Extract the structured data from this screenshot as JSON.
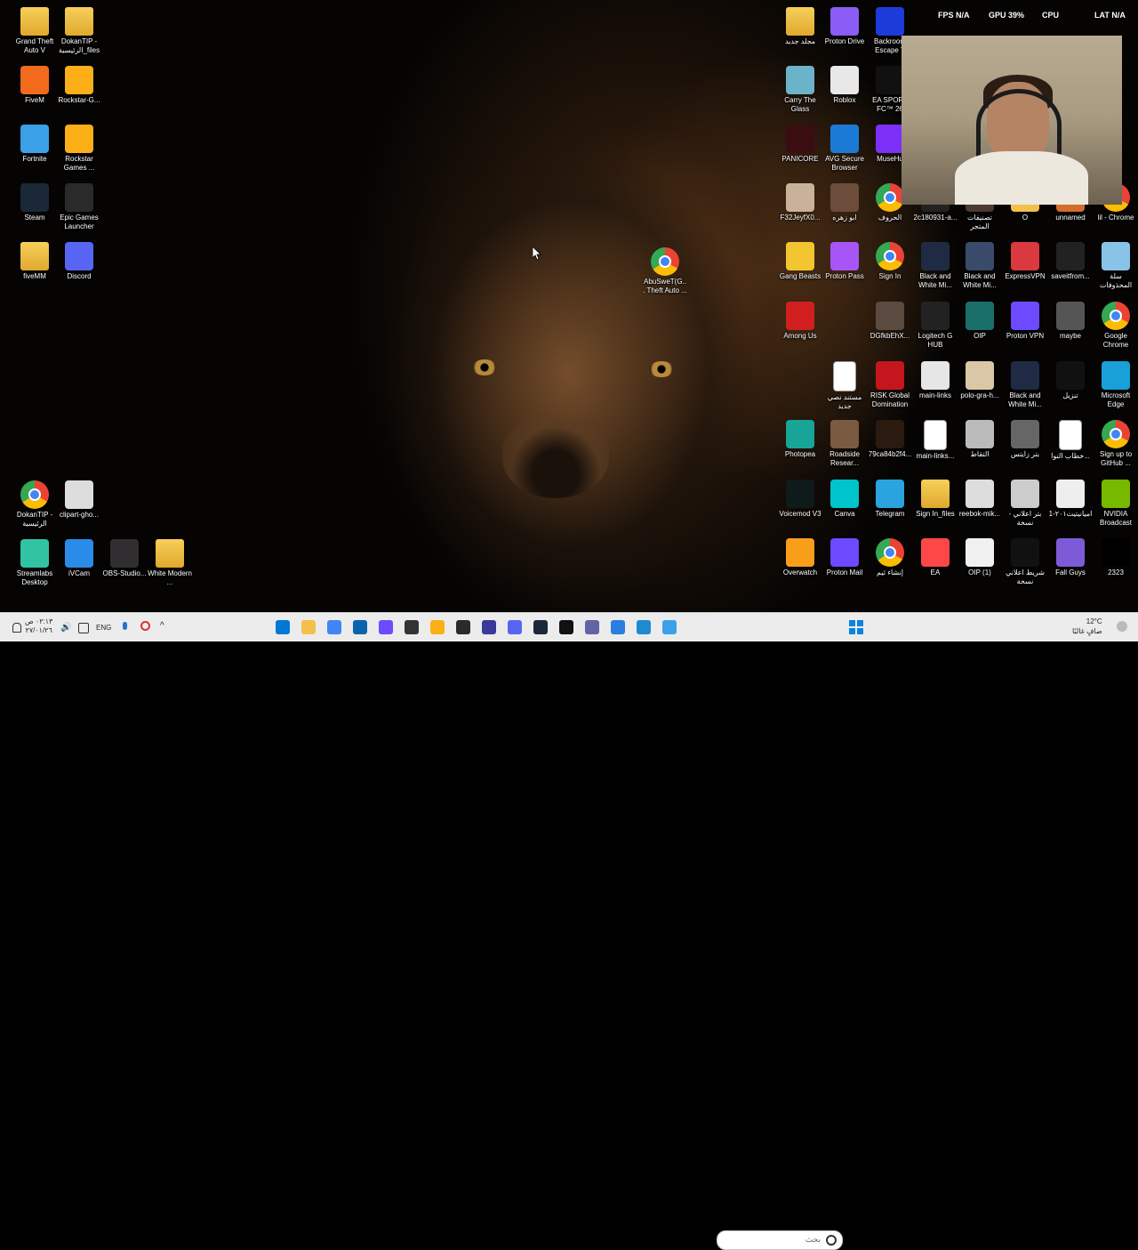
{
  "desktop_left": [
    {
      "label": "Grand Theft Auto V",
      "icon": "folder-icon",
      "kind": "folder"
    },
    {
      "label": "DokanTIP - الرئيسية_files",
      "icon": "folder-icon",
      "kind": "folder"
    },
    {
      "label": "FiveM",
      "icon": "fivem-icon",
      "color": "#f26a1b"
    },
    {
      "label": "Rockstar-G...",
      "icon": "rockstar-icon",
      "color": "#fcaf17"
    },
    {
      "label": "Fortnite",
      "icon": "fortnite-icon",
      "color": "#3aa0e8"
    },
    {
      "label": "Rockstar Games ...",
      "icon": "rockstar-icon",
      "color": "#fcaf17"
    },
    {
      "label": "Steam",
      "icon": "steam-icon",
      "color": "#1b2838"
    },
    {
      "label": "Epic Games Launcher",
      "icon": "epic-icon",
      "color": "#2a2a2a"
    },
    {
      "label": "fiveMM",
      "icon": "folder-icon",
      "kind": "folder"
    },
    {
      "label": "Discord",
      "icon": "discord-icon",
      "color": "#5865f2"
    },
    {
      "label": "DokanTIP - الرئيسية",
      "icon": "chrome-icon",
      "kind": "chrome"
    },
    {
      "label": "clipart-gho...",
      "icon": "ghost-icon",
      "color": "#dddddd"
    },
    {
      "label": "Streamlabs Desktop",
      "icon": "streamlabs-icon",
      "color": "#31c3a2"
    },
    {
      "label": "iVCam",
      "icon": "ivcam-icon",
      "color": "#2a8be8"
    },
    {
      "label": "OBS-Studio...",
      "icon": "obs-icon",
      "color": "#302e31"
    },
    {
      "label": "White Modern ...",
      "icon": "folder-icon",
      "kind": "folder"
    }
  ],
  "desktop_center": {
    "label": "AbuSweT(G... Theft Auto ...",
    "icon": "chrome-icon"
  },
  "desktop_right": [
    {
      "label": "مجلد جديد",
      "icon": "folder-icon",
      "kind": "folder"
    },
    {
      "label": "Proton Drive",
      "icon": "proton-drive-icon",
      "color": "#8b5cf6"
    },
    {
      "label": "Backroom Escape T",
      "icon": "backrooms-icon",
      "color": "#1d3bd8"
    },
    {
      "label": "Carry The Glass",
      "icon": "carry-glass-icon",
      "color": "#6bb3c9"
    },
    {
      "label": "Roblox",
      "icon": "roblox-icon",
      "color": "#e8e8e8"
    },
    {
      "label": "EA SPORT FC™ 26",
      "icon": "ea-fc-icon",
      "color": "#111111"
    },
    {
      "label": "PANICORE",
      "icon": "panicore-icon",
      "color": "#3b0d10"
    },
    {
      "label": "AVG Secure Browser",
      "icon": "avg-icon",
      "color": "#1c7ad7"
    },
    {
      "label": "MuseHu",
      "icon": "musehub-icon",
      "color": "#7b2ff7"
    },
    {
      "label": "F32JeyfX0...",
      "icon": "photo-icon",
      "color": "#c9b29a"
    },
    {
      "label": "ابو زهره",
      "icon": "photo-icon",
      "color": "#6c4c3a"
    },
    {
      "label": "الحروف",
      "icon": "chrome-icon",
      "kind": "chrome"
    },
    {
      "label": "2c180931-a...",
      "icon": "photo-icon",
      "color": "#222222"
    },
    {
      "label": "تصنيفات المتجر",
      "icon": "photo-icon",
      "color": "#4a3a30"
    },
    {
      "label": "O",
      "icon": "file-icon",
      "color": "#f3c04c"
    },
    {
      "label": "unnamed",
      "icon": "photo-icon",
      "color": "#d46d2a"
    },
    {
      "label": "lil - Chrome",
      "icon": "chrome-icon",
      "kind": "chrome"
    },
    {
      "label": "Gang Beasts",
      "icon": "gang-beasts-icon",
      "color": "#f2c531"
    },
    {
      "label": "Proton Pass",
      "icon": "proton-pass-icon",
      "color": "#a855f7"
    },
    {
      "label": "Sign In",
      "icon": "chrome-icon",
      "kind": "chrome"
    },
    {
      "label": "Black and White Mi...",
      "icon": "photo-icon",
      "color": "#1f2a44"
    },
    {
      "label": "Black and White Mi...",
      "icon": "photo-icon",
      "color": "#3a4a6a"
    },
    {
      "label": "ExpressVPN",
      "icon": "expressvpn-icon",
      "color": "#da3940"
    },
    {
      "label": "saveitfrom...",
      "icon": "photo-icon",
      "color": "#222222"
    },
    {
      "label": "سلة المحذوفات",
      "icon": "recycle-bin-icon",
      "color": "#89c4e8"
    },
    {
      "label": "Among Us",
      "icon": "among-us-icon",
      "color": "#d11f1f"
    },
    {
      "label": "DGfkbEhX...",
      "icon": "photo-icon",
      "color": "#5a4a40"
    },
    {
      "label": "Logitech G HUB",
      "icon": "logitech-icon",
      "color": "#222222"
    },
    {
      "label": "OIP",
      "icon": "photo-icon",
      "color": "#1a6f6a"
    },
    {
      "label": "Proton VPN",
      "icon": "proton-vpn-icon",
      "color": "#6d4aff"
    },
    {
      "label": "maybe",
      "icon": "photo-icon",
      "color": "#555555"
    },
    {
      "label": "Google Chrome",
      "icon": "chrome-icon",
      "kind": "chrome"
    },
    {
      "label": "مستند نصي جديد",
      "icon": "text-doc-icon",
      "kind": "doc"
    },
    {
      "label": "RISK Global Domination",
      "icon": "risk-icon",
      "color": "#c4161c"
    },
    {
      "label": "main-links",
      "icon": "photo-icon",
      "color": "#e6e6e6"
    },
    {
      "label": "polo-gra-h...",
      "icon": "photo-icon",
      "color": "#d9c7a8"
    },
    {
      "label": "Black and White Mi...",
      "icon": "photo-icon",
      "color": "#1f2a44"
    },
    {
      "label": "تنزيل",
      "icon": "photo-icon",
      "color": "#111111"
    },
    {
      "label": "Microsoft Edge",
      "icon": "edge-icon",
      "color": "#1aa0d8"
    },
    {
      "label": "Photopea",
      "icon": "photopea-icon",
      "color": "#18a497"
    },
    {
      "label": "Roadside Resear...",
      "icon": "photo-icon",
      "color": "#7a5a40"
    },
    {
      "label": "79ca84b2f4...",
      "icon": "photo-icon",
      "color": "#2a1a10"
    },
    {
      "label": "main-links...",
      "icon": "text-doc-icon",
      "kind": "doc"
    },
    {
      "label": "التقاط",
      "icon": "photo-icon",
      "color": "#bbbbbb"
    },
    {
      "label": "بتر زايتس",
      "icon": "photo-icon",
      "color": "#666666"
    },
    {
      "label": "خطاب النوا...",
      "icon": "text-doc-icon",
      "kind": "doc"
    },
    {
      "label": "Sign up to GitHub ...",
      "icon": "chrome-icon",
      "kind": "chrome"
    },
    {
      "label": "Voicemod V3",
      "icon": "voicemod-icon",
      "color": "#0f1a1a"
    },
    {
      "label": "Canva",
      "icon": "canva-icon",
      "color": "#00c4cc"
    },
    {
      "label": "Telegram",
      "icon": "telegram-icon",
      "color": "#2aa3df"
    },
    {
      "label": "Sign In_files",
      "icon": "folder-icon",
      "kind": "folder"
    },
    {
      "label": "reebok-mik...",
      "icon": "photo-icon",
      "color": "#dddddd"
    },
    {
      "label": "بتر اعلاني - نسخة",
      "icon": "photo-icon",
      "color": "#cccccc"
    },
    {
      "label": "اميانيتيت٢٠١-1",
      "icon": "photo-icon",
      "color": "#eeeeee"
    },
    {
      "label": "NVIDIA Broadcast",
      "icon": "nvidia-icon",
      "color": "#76b900"
    },
    {
      "label": "Overwatch",
      "icon": "overwatch-icon",
      "color": "#f99e1a"
    },
    {
      "label": "Proton Mail",
      "icon": "proton-mail-icon",
      "color": "#6d4aff"
    },
    {
      "label": "إنشاء ثيم",
      "icon": "chrome-icon",
      "kind": "chrome"
    },
    {
      "label": "EA",
      "icon": "ea-icon",
      "color": "#ff4747"
    },
    {
      "label": "OIP (1)",
      "icon": "photo-icon",
      "color": "#f0f0f0"
    },
    {
      "label": "شريط اعلاني نسخة",
      "icon": "photo-icon",
      "color": "#111111"
    },
    {
      "label": "Fall Guys",
      "icon": "fall-guys-icon",
      "color": "#7d5bd6"
    },
    {
      "label": "2323",
      "icon": "photo-icon",
      "color": "#000000"
    }
  ],
  "perf_overlay": {
    "fps_label": "FPS",
    "fps_value": "N/A",
    "gpu_label": "GPU",
    "gpu_value": "39%",
    "cpu_label": "CPU",
    "lat_label": "LAT",
    "lat_value": "N/A"
  },
  "taskbar": {
    "weather_temp": "12°C",
    "weather_desc": "صافٍ غالبًا",
    "search_placeholder": "بحث",
    "lang": "ENG",
    "clock_time": "٠٢:١٣ ص",
    "clock_date": "٢٧/٠١/٢٦",
    "apps": [
      {
        "icon": "start-icon",
        "color": "#0078d4"
      },
      {
        "icon": "file-explorer-icon",
        "color": "#f3c04c"
      },
      {
        "icon": "chrome-icon",
        "color": "#4285f4"
      },
      {
        "icon": "outlook-icon",
        "color": "#0a64ad"
      },
      {
        "icon": "proton-vpn-icon",
        "color": "#6d4aff"
      },
      {
        "icon": "notepad-icon",
        "color": "#333333"
      },
      {
        "icon": "rockstar-icon",
        "color": "#fcaf17"
      },
      {
        "icon": "epic-icon",
        "color": "#2a2a2a"
      },
      {
        "icon": "headset-icon",
        "color": "#3a3a9a"
      },
      {
        "icon": "discord-icon",
        "color": "#5865f2"
      },
      {
        "icon": "steam-icon",
        "color": "#1b2838"
      },
      {
        "icon": "capcut-icon",
        "color": "#111111"
      },
      {
        "icon": "teams-icon",
        "color": "#6264a7"
      },
      {
        "icon": "capture-icon",
        "color": "#2a7de1"
      },
      {
        "icon": "notes-icon",
        "color": "#1f8ad2"
      },
      {
        "icon": "copilot-icon",
        "color": "#3ba0e8"
      }
    ]
  }
}
